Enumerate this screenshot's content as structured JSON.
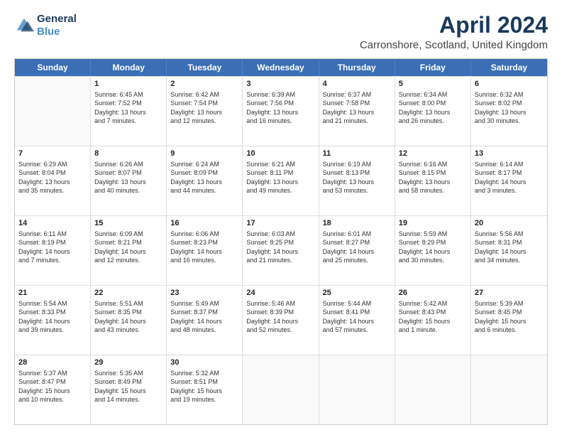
{
  "logo": {
    "line1": "General",
    "line2": "Blue"
  },
  "title": "April 2024",
  "subtitle": "Carronshore, Scotland, United Kingdom",
  "days": [
    "Sunday",
    "Monday",
    "Tuesday",
    "Wednesday",
    "Thursday",
    "Friday",
    "Saturday"
  ],
  "rows": [
    [
      {
        "day": "",
        "data": []
      },
      {
        "day": "1",
        "data": [
          "Sunrise: 6:45 AM",
          "Sunset: 7:52 PM",
          "Daylight: 13 hours",
          "and 7 minutes."
        ]
      },
      {
        "day": "2",
        "data": [
          "Sunrise: 6:42 AM",
          "Sunset: 7:54 PM",
          "Daylight: 13 hours",
          "and 12 minutes."
        ]
      },
      {
        "day": "3",
        "data": [
          "Sunrise: 6:39 AM",
          "Sunset: 7:56 PM",
          "Daylight: 13 hours",
          "and 16 minutes."
        ]
      },
      {
        "day": "4",
        "data": [
          "Sunrise: 6:37 AM",
          "Sunset: 7:58 PM",
          "Daylight: 13 hours",
          "and 21 minutes."
        ]
      },
      {
        "day": "5",
        "data": [
          "Sunrise: 6:34 AM",
          "Sunset: 8:00 PM",
          "Daylight: 13 hours",
          "and 26 minutes."
        ]
      },
      {
        "day": "6",
        "data": [
          "Sunrise: 6:32 AM",
          "Sunset: 8:02 PM",
          "Daylight: 13 hours",
          "and 30 minutes."
        ]
      }
    ],
    [
      {
        "day": "7",
        "data": [
          "Sunrise: 6:29 AM",
          "Sunset: 8:04 PM",
          "Daylight: 13 hours",
          "and 35 minutes."
        ]
      },
      {
        "day": "8",
        "data": [
          "Sunrise: 6:26 AM",
          "Sunset: 8:07 PM",
          "Daylight: 13 hours",
          "and 40 minutes."
        ]
      },
      {
        "day": "9",
        "data": [
          "Sunrise: 6:24 AM",
          "Sunset: 8:09 PM",
          "Daylight: 13 hours",
          "and 44 minutes."
        ]
      },
      {
        "day": "10",
        "data": [
          "Sunrise: 6:21 AM",
          "Sunset: 8:11 PM",
          "Daylight: 13 hours",
          "and 49 minutes."
        ]
      },
      {
        "day": "11",
        "data": [
          "Sunrise: 6:19 AM",
          "Sunset: 8:13 PM",
          "Daylight: 13 hours",
          "and 53 minutes."
        ]
      },
      {
        "day": "12",
        "data": [
          "Sunrise: 6:16 AM",
          "Sunset: 8:15 PM",
          "Daylight: 13 hours",
          "and 58 minutes."
        ]
      },
      {
        "day": "13",
        "data": [
          "Sunrise: 6:14 AM",
          "Sunset: 8:17 PM",
          "Daylight: 14 hours",
          "and 3 minutes."
        ]
      }
    ],
    [
      {
        "day": "14",
        "data": [
          "Sunrise: 6:11 AM",
          "Sunset: 8:19 PM",
          "Daylight: 14 hours",
          "and 7 minutes."
        ]
      },
      {
        "day": "15",
        "data": [
          "Sunrise: 6:09 AM",
          "Sunset: 8:21 PM",
          "Daylight: 14 hours",
          "and 12 minutes."
        ]
      },
      {
        "day": "16",
        "data": [
          "Sunrise: 6:06 AM",
          "Sunset: 8:23 PM",
          "Daylight: 14 hours",
          "and 16 minutes."
        ]
      },
      {
        "day": "17",
        "data": [
          "Sunrise: 6:03 AM",
          "Sunset: 8:25 PM",
          "Daylight: 14 hours",
          "and 21 minutes."
        ]
      },
      {
        "day": "18",
        "data": [
          "Sunrise: 6:01 AM",
          "Sunset: 8:27 PM",
          "Daylight: 14 hours",
          "and 25 minutes."
        ]
      },
      {
        "day": "19",
        "data": [
          "Sunrise: 5:59 AM",
          "Sunset: 8:29 PM",
          "Daylight: 14 hours",
          "and 30 minutes."
        ]
      },
      {
        "day": "20",
        "data": [
          "Sunrise: 5:56 AM",
          "Sunset: 8:31 PM",
          "Daylight: 14 hours",
          "and 34 minutes."
        ]
      }
    ],
    [
      {
        "day": "21",
        "data": [
          "Sunrise: 5:54 AM",
          "Sunset: 8:33 PM",
          "Daylight: 14 hours",
          "and 39 minutes."
        ]
      },
      {
        "day": "22",
        "data": [
          "Sunrise: 5:51 AM",
          "Sunset: 8:35 PM",
          "Daylight: 14 hours",
          "and 43 minutes."
        ]
      },
      {
        "day": "23",
        "data": [
          "Sunrise: 5:49 AM",
          "Sunset: 8:37 PM",
          "Daylight: 14 hours",
          "and 48 minutes."
        ]
      },
      {
        "day": "24",
        "data": [
          "Sunrise: 5:46 AM",
          "Sunset: 8:39 PM",
          "Daylight: 14 hours",
          "and 52 minutes."
        ]
      },
      {
        "day": "25",
        "data": [
          "Sunrise: 5:44 AM",
          "Sunset: 8:41 PM",
          "Daylight: 14 hours",
          "and 57 minutes."
        ]
      },
      {
        "day": "26",
        "data": [
          "Sunrise: 5:42 AM",
          "Sunset: 8:43 PM",
          "Daylight: 15 hours",
          "and 1 minute."
        ]
      },
      {
        "day": "27",
        "data": [
          "Sunrise: 5:39 AM",
          "Sunset: 8:45 PM",
          "Daylight: 15 hours",
          "and 6 minutes."
        ]
      }
    ],
    [
      {
        "day": "28",
        "data": [
          "Sunrise: 5:37 AM",
          "Sunset: 8:47 PM",
          "Daylight: 15 hours",
          "and 10 minutes."
        ]
      },
      {
        "day": "29",
        "data": [
          "Sunrise: 5:35 AM",
          "Sunset: 8:49 PM",
          "Daylight: 15 hours",
          "and 14 minutes."
        ]
      },
      {
        "day": "30",
        "data": [
          "Sunrise: 5:32 AM",
          "Sunset: 8:51 PM",
          "Daylight: 15 hours",
          "and 19 minutes."
        ]
      },
      {
        "day": "",
        "data": []
      },
      {
        "day": "",
        "data": []
      },
      {
        "day": "",
        "data": []
      },
      {
        "day": "",
        "data": []
      }
    ]
  ]
}
